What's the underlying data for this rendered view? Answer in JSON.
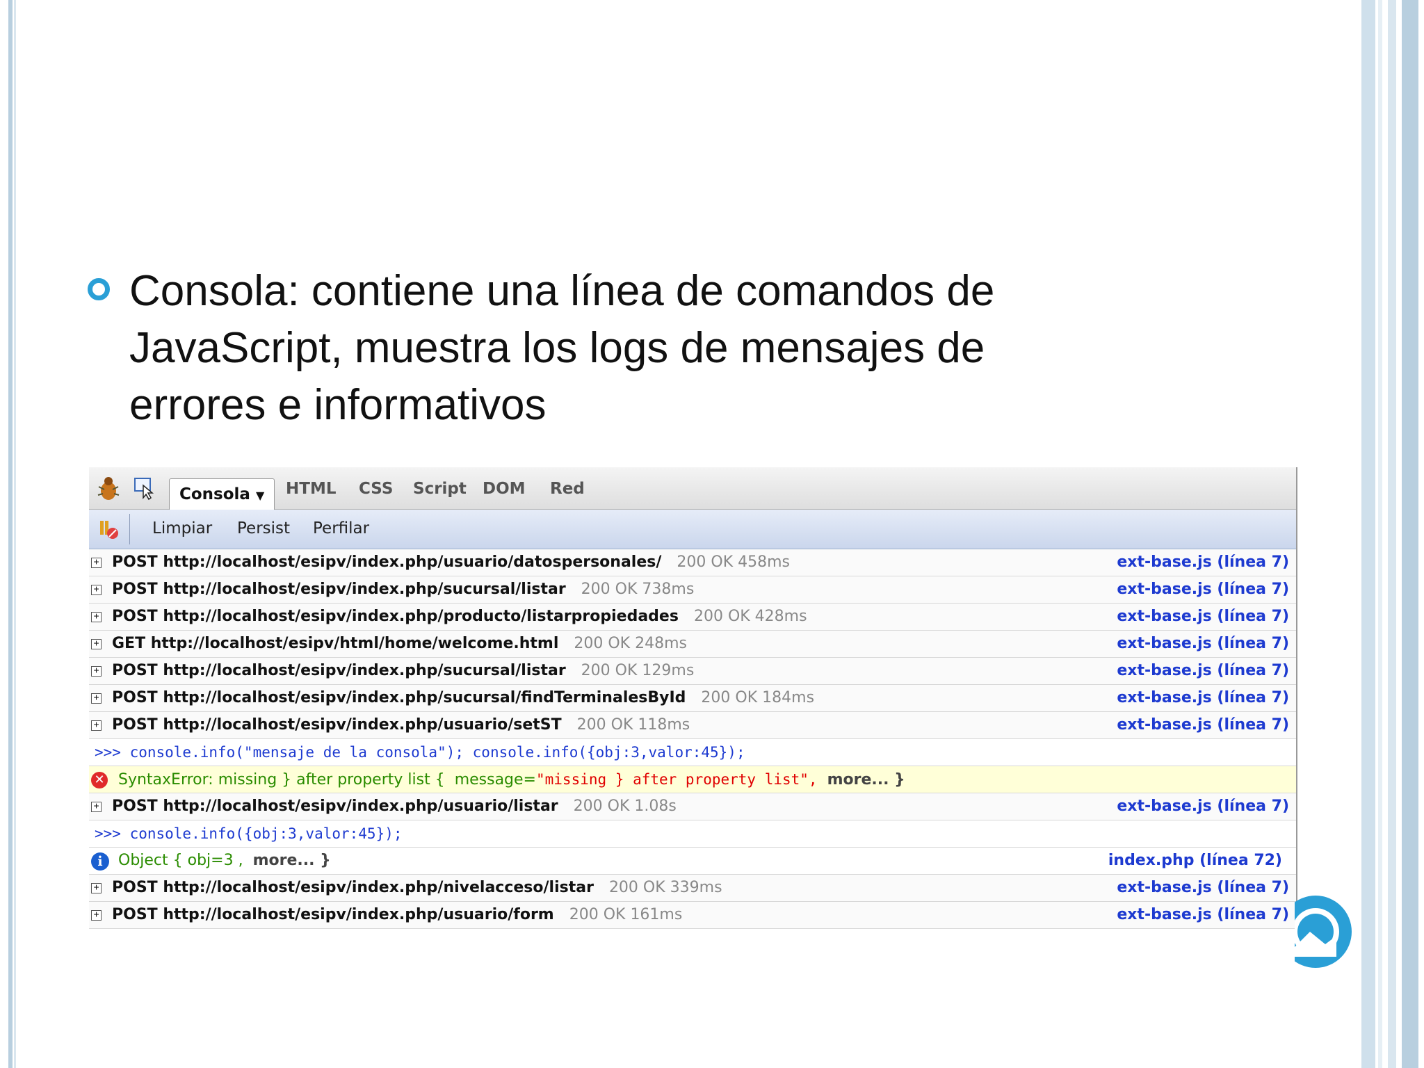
{
  "bullet": {
    "text": "Consola: contiene una línea de comandos de JavaScript, muestra los logs de mensajes de errores e informativos"
  },
  "firebug": {
    "tabs": [
      "Consola",
      "HTML",
      "CSS",
      "Script",
      "DOM",
      "Red"
    ],
    "active_tab": "Consola",
    "subbar": {
      "clear": "Limpiar",
      "persist": "Persist",
      "profile": "Perfilar"
    },
    "rows": [
      {
        "type": "request",
        "text": "POST http://localhost/esipv/index.php/usuario/datospersonales/",
        "status": "200 OK 458ms",
        "source": "ext-base.js (línea 7)"
      },
      {
        "type": "request",
        "text": "POST http://localhost/esipv/index.php/sucursal/listar",
        "status": "200 OK 738ms",
        "source": "ext-base.js (línea 7)"
      },
      {
        "type": "request",
        "text": "POST http://localhost/esipv/index.php/producto/listarpropiedades",
        "status": "200 OK 428ms",
        "source": "ext-base.js (línea 7)"
      },
      {
        "type": "request",
        "text": "GET http://localhost/esipv/html/home/welcome.html",
        "status": "200 OK 248ms",
        "source": "ext-base.js (línea 7)"
      },
      {
        "type": "request",
        "text": "POST http://localhost/esipv/index.php/sucursal/listar",
        "status": "200 OK 129ms",
        "source": "ext-base.js (línea 7)"
      },
      {
        "type": "request",
        "text": "POST http://localhost/esipv/index.php/sucursal/findTerminalesById",
        "status": "200 OK 184ms",
        "source": "ext-base.js (línea 7)"
      },
      {
        "type": "request",
        "text": "POST http://localhost/esipv/index.php/usuario/setST",
        "status": "200 OK 118ms",
        "source": "ext-base.js (línea 7)"
      },
      {
        "type": "command",
        "text": ">>> console.info(\"mensaje de la consola\"); console.info({obj:3,valor:45});"
      },
      {
        "type": "error",
        "label": "SyntaxError: missing } after property list {",
        "key": "message=",
        "value": "\"missing } after property list\",",
        "more": "more... }"
      },
      {
        "type": "request",
        "text": "POST http://localhost/esipv/index.php/usuario/listar",
        "status": "200 OK 1.08s",
        "source": "ext-base.js (línea 7)"
      },
      {
        "type": "command",
        "text": ">>>  console.info({obj:3,valor:45});"
      },
      {
        "type": "info",
        "label": "Object { obj=3 ,",
        "more": "more... }",
        "source": "index.php (línea 72)"
      },
      {
        "type": "request",
        "text": "POST http://localhost/esipv/index.php/nivelacceso/listar",
        "status": "200 OK 339ms",
        "source": "ext-base.js (línea 7)"
      },
      {
        "type": "request",
        "text": "POST http://localhost/esipv/index.php/usuario/form",
        "status": "200 OK 161ms",
        "source": "ext-base.js (línea 7)"
      }
    ]
  },
  "colors": {
    "accent": "#2a9fd6",
    "link": "#1d3ad0",
    "error_bg": "#ffffd8"
  }
}
